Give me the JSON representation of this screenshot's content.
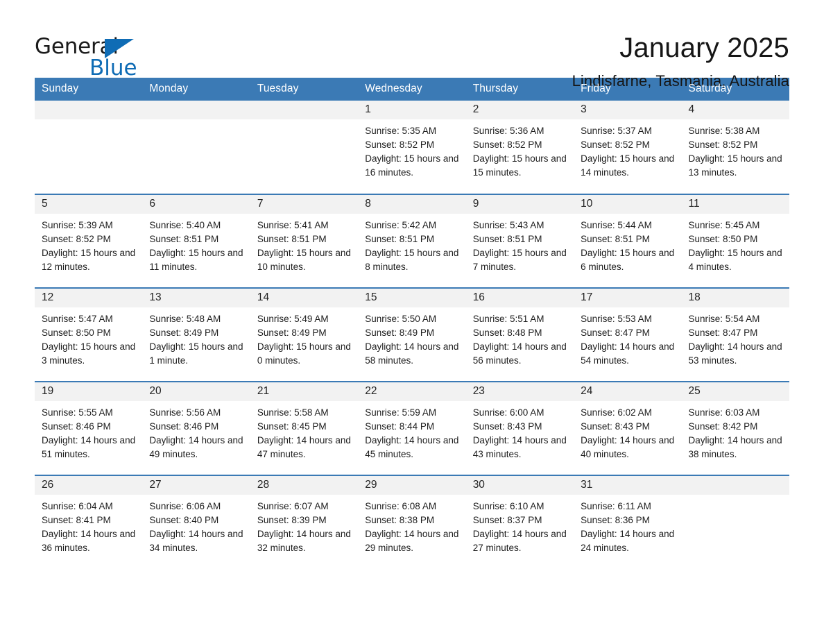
{
  "logo": {
    "word_one": "General",
    "word_two": "Blue",
    "triangle_color": "#0f6cb5"
  },
  "header": {
    "title": "January 2025",
    "location": "Lindisfarne, Tasmania, Australia"
  },
  "theme": {
    "header_blue": "#3b7ab5",
    "daynum_band": "#f2f2f2",
    "text": "#1d1d1d"
  },
  "calendar": {
    "weekday_headers": [
      "Sunday",
      "Monday",
      "Tuesday",
      "Wednesday",
      "Thursday",
      "Friday",
      "Saturday"
    ],
    "weeks": [
      [
        {
          "day": "",
          "info": ""
        },
        {
          "day": "",
          "info": ""
        },
        {
          "day": "",
          "info": ""
        },
        {
          "day": "1",
          "info": "Sunrise: 5:35 AM\nSunset: 8:52 PM\nDaylight: 15 hours and 16 minutes."
        },
        {
          "day": "2",
          "info": "Sunrise: 5:36 AM\nSunset: 8:52 PM\nDaylight: 15 hours and 15 minutes."
        },
        {
          "day": "3",
          "info": "Sunrise: 5:37 AM\nSunset: 8:52 PM\nDaylight: 15 hours and 14 minutes."
        },
        {
          "day": "4",
          "info": "Sunrise: 5:38 AM\nSunset: 8:52 PM\nDaylight: 15 hours and 13 minutes."
        }
      ],
      [
        {
          "day": "5",
          "info": "Sunrise: 5:39 AM\nSunset: 8:52 PM\nDaylight: 15 hours and 12 minutes."
        },
        {
          "day": "6",
          "info": "Sunrise: 5:40 AM\nSunset: 8:51 PM\nDaylight: 15 hours and 11 minutes."
        },
        {
          "day": "7",
          "info": "Sunrise: 5:41 AM\nSunset: 8:51 PM\nDaylight: 15 hours and 10 minutes."
        },
        {
          "day": "8",
          "info": "Sunrise: 5:42 AM\nSunset: 8:51 PM\nDaylight: 15 hours and 8 minutes."
        },
        {
          "day": "9",
          "info": "Sunrise: 5:43 AM\nSunset: 8:51 PM\nDaylight: 15 hours and 7 minutes."
        },
        {
          "day": "10",
          "info": "Sunrise: 5:44 AM\nSunset: 8:51 PM\nDaylight: 15 hours and 6 minutes."
        },
        {
          "day": "11",
          "info": "Sunrise: 5:45 AM\nSunset: 8:50 PM\nDaylight: 15 hours and 4 minutes."
        }
      ],
      [
        {
          "day": "12",
          "info": "Sunrise: 5:47 AM\nSunset: 8:50 PM\nDaylight: 15 hours and 3 minutes."
        },
        {
          "day": "13",
          "info": "Sunrise: 5:48 AM\nSunset: 8:49 PM\nDaylight: 15 hours and 1 minute."
        },
        {
          "day": "14",
          "info": "Sunrise: 5:49 AM\nSunset: 8:49 PM\nDaylight: 15 hours and 0 minutes."
        },
        {
          "day": "15",
          "info": "Sunrise: 5:50 AM\nSunset: 8:49 PM\nDaylight: 14 hours and 58 minutes."
        },
        {
          "day": "16",
          "info": "Sunrise: 5:51 AM\nSunset: 8:48 PM\nDaylight: 14 hours and 56 minutes."
        },
        {
          "day": "17",
          "info": "Sunrise: 5:53 AM\nSunset: 8:47 PM\nDaylight: 14 hours and 54 minutes."
        },
        {
          "day": "18",
          "info": "Sunrise: 5:54 AM\nSunset: 8:47 PM\nDaylight: 14 hours and 53 minutes."
        }
      ],
      [
        {
          "day": "19",
          "info": "Sunrise: 5:55 AM\nSunset: 8:46 PM\nDaylight: 14 hours and 51 minutes."
        },
        {
          "day": "20",
          "info": "Sunrise: 5:56 AM\nSunset: 8:46 PM\nDaylight: 14 hours and 49 minutes."
        },
        {
          "day": "21",
          "info": "Sunrise: 5:58 AM\nSunset: 8:45 PM\nDaylight: 14 hours and 47 minutes."
        },
        {
          "day": "22",
          "info": "Sunrise: 5:59 AM\nSunset: 8:44 PM\nDaylight: 14 hours and 45 minutes."
        },
        {
          "day": "23",
          "info": "Sunrise: 6:00 AM\nSunset: 8:43 PM\nDaylight: 14 hours and 43 minutes."
        },
        {
          "day": "24",
          "info": "Sunrise: 6:02 AM\nSunset: 8:43 PM\nDaylight: 14 hours and 40 minutes."
        },
        {
          "day": "25",
          "info": "Sunrise: 6:03 AM\nSunset: 8:42 PM\nDaylight: 14 hours and 38 minutes."
        }
      ],
      [
        {
          "day": "26",
          "info": "Sunrise: 6:04 AM\nSunset: 8:41 PM\nDaylight: 14 hours and 36 minutes."
        },
        {
          "day": "27",
          "info": "Sunrise: 6:06 AM\nSunset: 8:40 PM\nDaylight: 14 hours and 34 minutes."
        },
        {
          "day": "28",
          "info": "Sunrise: 6:07 AM\nSunset: 8:39 PM\nDaylight: 14 hours and 32 minutes."
        },
        {
          "day": "29",
          "info": "Sunrise: 6:08 AM\nSunset: 8:38 PM\nDaylight: 14 hours and 29 minutes."
        },
        {
          "day": "30",
          "info": "Sunrise: 6:10 AM\nSunset: 8:37 PM\nDaylight: 14 hours and 27 minutes."
        },
        {
          "day": "31",
          "info": "Sunrise: 6:11 AM\nSunset: 8:36 PM\nDaylight: 14 hours and 24 minutes."
        },
        {
          "day": "",
          "info": ""
        }
      ]
    ]
  }
}
